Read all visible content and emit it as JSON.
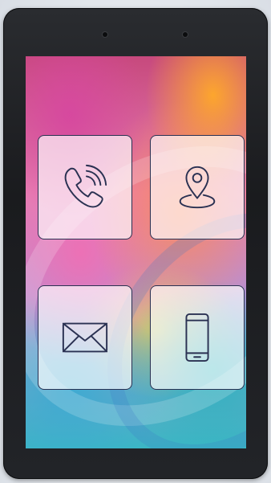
{
  "device": {
    "type": "tablet",
    "frame_color": "#1e1f22"
  },
  "home_screen": {
    "tiles": [
      {
        "name": "phone",
        "icon": "phone-call-icon"
      },
      {
        "name": "location",
        "icon": "map-pin-icon"
      },
      {
        "name": "mail",
        "icon": "envelope-icon"
      },
      {
        "name": "device",
        "icon": "smartphone-icon"
      }
    ],
    "icon_color": "#2a3152"
  }
}
